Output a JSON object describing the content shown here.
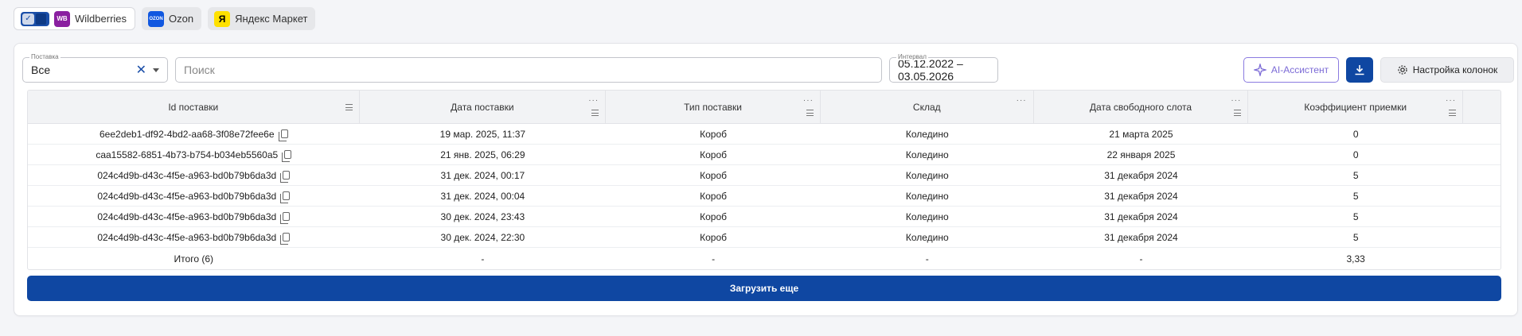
{
  "marketplaces": [
    {
      "label": "Wildberries",
      "logo": "WB",
      "active": true
    },
    {
      "label": "Ozon",
      "logo": "OZON",
      "active": false
    },
    {
      "label": "Яндекс Маркет",
      "logo": "Я",
      "active": false
    }
  ],
  "filters": {
    "supply_label": "Поставка",
    "supply_value": "Все",
    "search_placeholder": "Поиск",
    "interval_label": "Интервал",
    "interval_value": "05.12.2022 – 03.05.2026"
  },
  "toolbar": {
    "ai_label": "AI-Ассистент",
    "columns_label": "Настройка колонок"
  },
  "table": {
    "columns": [
      "Id поставки",
      "Дата поставки",
      "Тип поставки",
      "Склад",
      "Дата свободного слота",
      "Коэффициент приемки"
    ],
    "rows": [
      [
        "6ee2deb1-df92-4bd2-aa68-3f08e72fee6e",
        "19 мар. 2025, 11:37",
        "Короб",
        "Коледино",
        "21 марта 2025",
        "0"
      ],
      [
        "caa15582-6851-4b73-b754-b034eb5560a5",
        "21 янв. 2025, 06:29",
        "Короб",
        "Коледино",
        "22 января 2025",
        "0"
      ],
      [
        "024c4d9b-d43c-4f5e-a963-bd0b79b6da3d",
        "31 дек. 2024, 00:17",
        "Короб",
        "Коледино",
        "31 декабря 2024",
        "5"
      ],
      [
        "024c4d9b-d43c-4f5e-a963-bd0b79b6da3d",
        "31 дек. 2024, 00:04",
        "Короб",
        "Коледино",
        "31 декабря 2024",
        "5"
      ],
      [
        "024c4d9b-d43c-4f5e-a963-bd0b79b6da3d",
        "30 дек. 2024, 23:43",
        "Короб",
        "Коледино",
        "31 декабря 2024",
        "5"
      ],
      [
        "024c4d9b-d43c-4f5e-a963-bd0b79b6da3d",
        "30 дек. 2024, 22:30",
        "Короб",
        "Коледино",
        "31 декабря 2024",
        "5"
      ]
    ],
    "totals": [
      "Итого (6)",
      "-",
      "-",
      "-",
      "-",
      "3,33"
    ]
  },
  "load_more_label": "Загрузить еще",
  "colors": {
    "primary": "#0f47a2",
    "ai_accent": "#7b6ad6"
  }
}
